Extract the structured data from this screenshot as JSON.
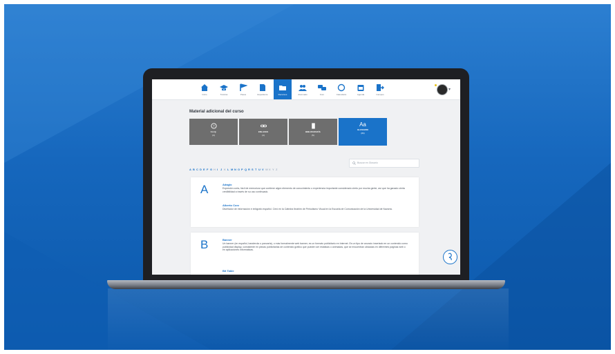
{
  "nav": {
    "items": [
      {
        "label": "Inicio",
        "icon": "home-icon"
      },
      {
        "label": "Tutorías",
        "icon": "graduation-cap-icon"
      },
      {
        "label": "Pasos",
        "icon": "flag-icon"
      },
      {
        "label": "Expediente",
        "icon": "document-icon"
      },
      {
        "label": "Recursos",
        "icon": "folder-icon",
        "active": true
      },
      {
        "label": "Alumnado",
        "icon": "people-icon"
      },
      {
        "label": "Foro",
        "icon": "chat-icon"
      },
      {
        "label": "Calendario",
        "icon": "clock-icon"
      },
      {
        "label": "Agenda",
        "icon": "calendar-icon"
      },
      {
        "label": "Campus",
        "icon": "exit-icon"
      }
    ]
  },
  "page": {
    "title": "Material adicional del curso"
  },
  "cards": [
    {
      "title": "F.A.Q.",
      "count": "(3)",
      "icon": "faq-icon"
    },
    {
      "title": "ENLACES",
      "count": "(4)",
      "icon": "link-icon"
    },
    {
      "title": "BIBLIOGRAFÍA",
      "count": "(5)",
      "icon": "book-icon"
    },
    {
      "title": "GLOSARIO",
      "count": "(83)",
      "icon": "glossary-icon",
      "glyph": "Aa",
      "active": true
    }
  ],
  "alphabet": {
    "letters": [
      "A",
      "B",
      "C",
      "D",
      "E",
      "F",
      "G",
      "H",
      "I",
      "J",
      "K",
      "L",
      "M",
      "N",
      "O",
      "P",
      "Q",
      "R",
      "S",
      "T",
      "U",
      "V",
      "W",
      "X",
      "Y",
      "Z"
    ],
    "disabled": [
      "H",
      "K",
      "Ñ",
      "W",
      "X",
      "Y",
      "Z"
    ]
  },
  "search": {
    "placeholder": "Buscar en Glosario"
  },
  "entries": [
    {
      "letter": "A",
      "items": [
        {
          "term": "Adagio",
          "definition": "Expresión corta, fácil de memorizar que contiene algún elemento de conocimiento o experiencia importante considerado cierto por mucha gente, así que ha ganado cierta credibilidad a través de su uso continuado."
        },
        {
          "term": "Alberto Corz",
          "definition": "Diseñador de información e infógrafo español. Creó en la Cátedra Ibrahim de Periodismo Visual en la Escuela de Comunicación de la Universidad de Navarra."
        }
      ]
    },
    {
      "letter": "B",
      "items": [
        {
          "term": "Banner",
          "definition": "Un banner (en español, banderola o pancarta), o más formalmente web banner, es un formato publicitario en Internet. Es un tipo de anuncio insertado en un contenido como publicidad display, consistente en piezas publicitarias de contenido gráfico que pueden ser estáticas o animadas, que se encuentran ubicadas en diferentes páginas web o en aplicaciones informáticas."
        },
        {
          "term": "Bit Table",
          "definition": ""
        }
      ]
    }
  ],
  "colors": {
    "accent": "#1a73c9",
    "card_inactive": "#6e6e6e",
    "background": "#1667bd"
  }
}
